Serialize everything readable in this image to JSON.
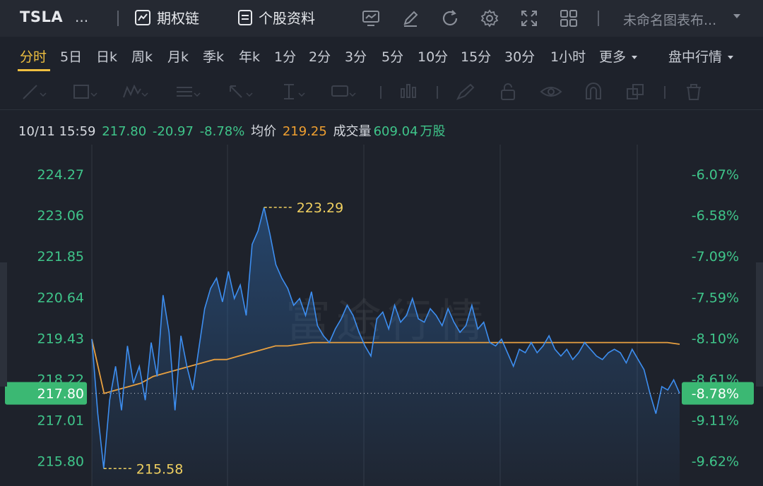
{
  "header": {
    "ticker": "TSLA",
    "ticker_more": "...",
    "options_chain": "期权链",
    "stock_profile": "个股资料",
    "icons": [
      "monitor-chart-icon",
      "pencil-edit-icon",
      "refresh-icon",
      "gear-icon",
      "fullscreen-icon",
      "grid-layout-icon"
    ],
    "chart_name": "未命名图表布..."
  },
  "tabs": {
    "items": [
      "分时",
      "5日",
      "日k",
      "周k",
      "月k",
      "季k",
      "年k",
      "1分",
      "2分",
      "3分",
      "5分",
      "10分",
      "15分",
      "30分",
      "1小时",
      "更多"
    ],
    "active": "分时",
    "intraday_quote": "盘中行情"
  },
  "tools": {
    "icons": [
      "trend-line-icon",
      "rectangle-icon",
      "pattern-icon",
      "fibonacci-icon",
      "arrow-icon",
      "price-range-icon",
      "annotation-icon",
      "indicator-icon",
      "brush-icon",
      "lock-icon",
      "eye-icon",
      "magnet-icon",
      "layers-icon",
      "trash-icon"
    ]
  },
  "info": {
    "datetime": "10/11 15:59",
    "price": "217.80",
    "change": "-20.97",
    "change_pct": "-8.78%",
    "avg_label": "均价",
    "avg_value": "219.25",
    "volume_label": "成交量",
    "volume_value": "609.04",
    "volume_unit": "万股"
  },
  "colors": {
    "price_line": "#3d8ef0",
    "avg_line": "#e8a040",
    "axis_green": "#3fc58a",
    "high_low_label": "#f0d060",
    "current_badge": "#3bb873"
  },
  "chart_data": {
    "type": "line",
    "watermark": "富途行情",
    "ylim": [
      215.3,
      224.77
    ],
    "left_ticks": [
      "224.27",
      "223.06",
      "221.85",
      "220.64",
      "219.43",
      "218.22",
      "217.01",
      "215.80"
    ],
    "right_ticks": [
      "-6.07%",
      "-6.58%",
      "-7.09%",
      "-7.59%",
      "-8.10%",
      "-8.61%",
      "-9.11%",
      "-9.62%"
    ],
    "high_label": "223.29",
    "low_label": "215.58",
    "current_price": "217.80",
    "current_pct": "-8.78%",
    "series": [
      {
        "name": "价格",
        "values": [
          219.4,
          217.2,
          215.58,
          217.6,
          218.6,
          217.3,
          219.2,
          218.1,
          218.6,
          217.6,
          219.3,
          218.3,
          220.7,
          219.6,
          217.3,
          219.5,
          218.6,
          217.9,
          219.1,
          220.3,
          220.9,
          221.2,
          220.5,
          221.4,
          220.6,
          221.0,
          220.1,
          222.2,
          222.6,
          223.29,
          222.5,
          221.6,
          221.2,
          220.9,
          220.4,
          220.6,
          220.1,
          220.8,
          219.8,
          219.5,
          219.3,
          219.7,
          220.0,
          220.4,
          220.1,
          219.6,
          219.2,
          218.9,
          220.0,
          220.2,
          219.7,
          220.4,
          219.9,
          220.1,
          220.6,
          220.0,
          219.9,
          220.3,
          220.1,
          219.8,
          220.3,
          219.9,
          219.6,
          219.8,
          220.4,
          219.7,
          219.9,
          219.3,
          219.2,
          219.4,
          219.0,
          218.6,
          219.1,
          219.0,
          219.3,
          219.0,
          219.2,
          219.5,
          219.1,
          218.9,
          219.1,
          218.8,
          219.0,
          219.3,
          219.1,
          218.9,
          218.8,
          219.0,
          219.1,
          219.0,
          218.7,
          219.1,
          218.8,
          218.5,
          217.8,
          217.2,
          218.0,
          217.9,
          218.2,
          217.8
        ]
      },
      {
        "name": "均价",
        "values": [
          219.4,
          217.8,
          217.9,
          218.0,
          218.1,
          218.3,
          218.4,
          218.5,
          218.6,
          218.7,
          218.8,
          218.8,
          218.9,
          219.0,
          219.1,
          219.2,
          219.2,
          219.25,
          219.3,
          219.3,
          219.3,
          219.3,
          219.3,
          219.3,
          219.3,
          219.3,
          219.3,
          219.3,
          219.3,
          219.3,
          219.3,
          219.3,
          219.3,
          219.3,
          219.3,
          219.3,
          219.3,
          219.3,
          219.3,
          219.3,
          219.3,
          219.3,
          219.3,
          219.3,
          219.3,
          219.3,
          219.3,
          219.3,
          219.25
        ]
      }
    ]
  }
}
